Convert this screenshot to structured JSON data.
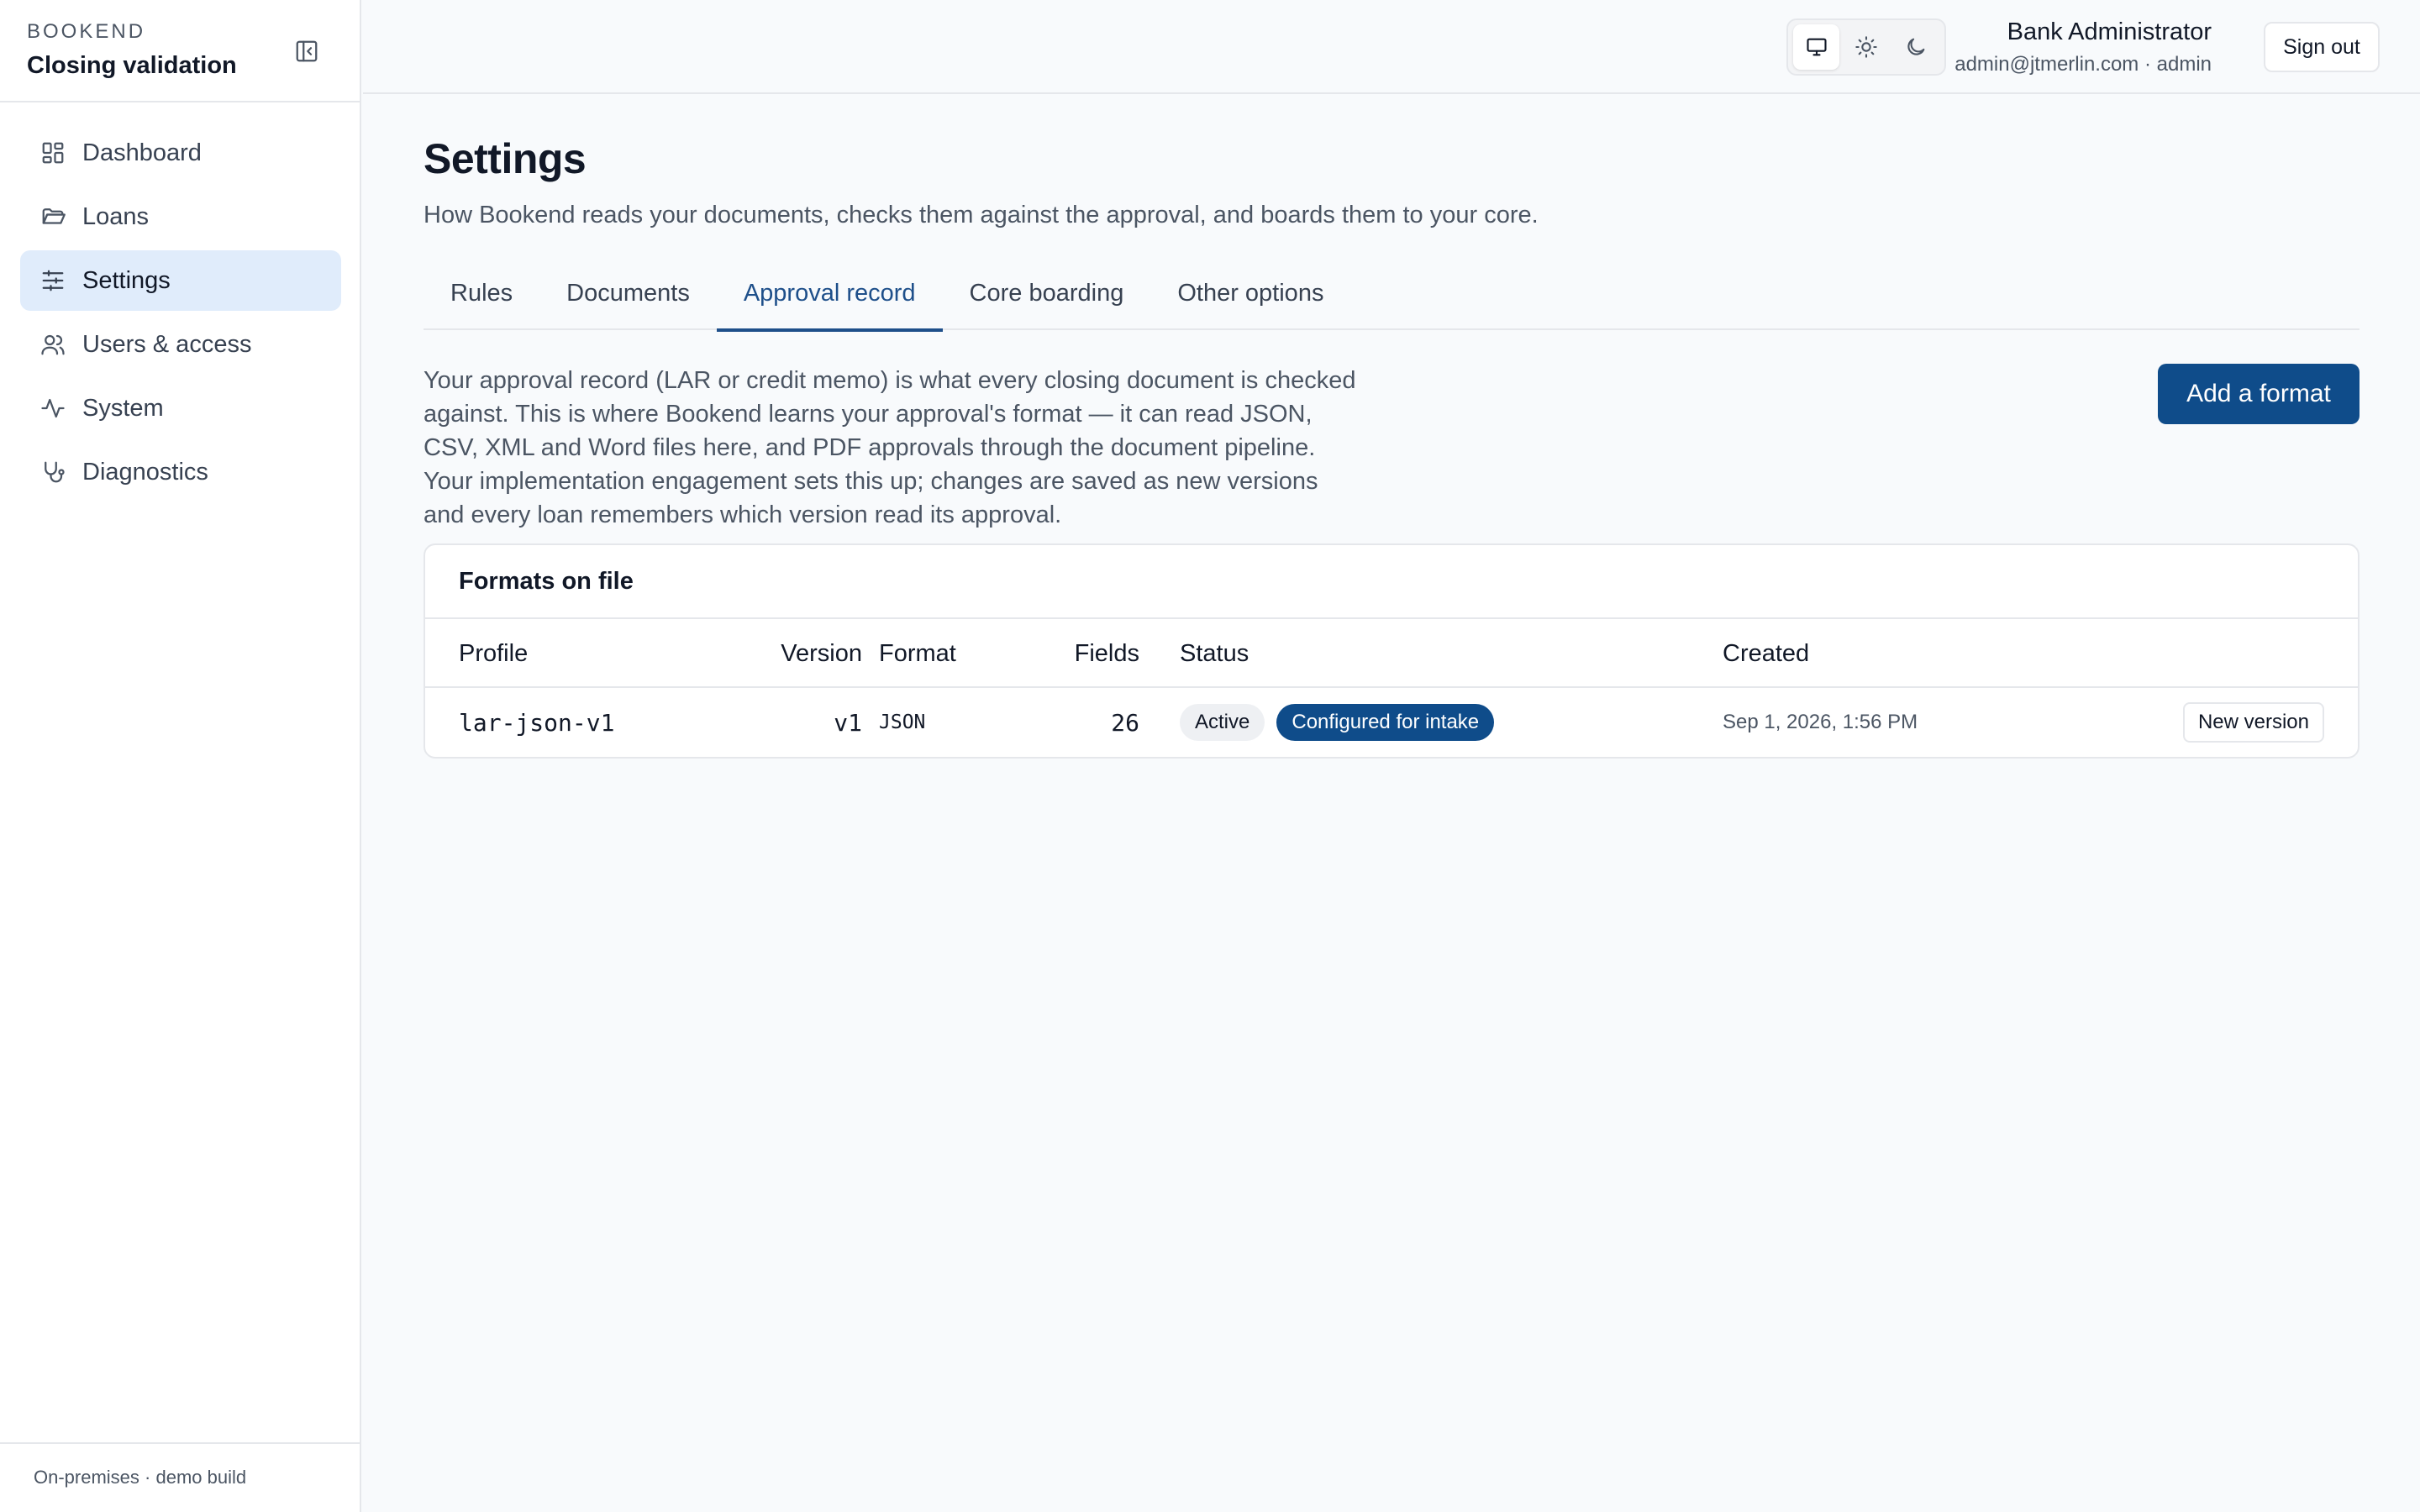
{
  "sidebar": {
    "brand": "BOOKEND",
    "subtitle": "Closing validation",
    "collapse_icon": "panel-collapse-icon",
    "items": [
      {
        "label": "Dashboard",
        "icon": "dashboard-icon",
        "active": false
      },
      {
        "label": "Loans",
        "icon": "folder-icon",
        "active": false
      },
      {
        "label": "Settings",
        "icon": "sliders-icon",
        "active": true
      },
      {
        "label": "Users & access",
        "icon": "users-icon",
        "active": false
      },
      {
        "label": "System",
        "icon": "activity-icon",
        "active": false
      },
      {
        "label": "Diagnostics",
        "icon": "stethoscope-icon",
        "active": false
      }
    ],
    "footer": "On-premises · demo build"
  },
  "header": {
    "theme_options": [
      "monitor-icon",
      "sun-icon",
      "moon-icon"
    ],
    "theme_selected": "monitor-icon",
    "user_name": "Bank Administrator",
    "user_email": "admin@jtmerlin.com · admin",
    "sign_out": "Sign out"
  },
  "main": {
    "title": "Settings",
    "description": "How Bookend reads your documents, checks them against the approval, and boards them to your core.",
    "tabs": [
      {
        "label": "Rules",
        "active": false
      },
      {
        "label": "Documents",
        "active": false
      },
      {
        "label": "Approval record",
        "active": true
      },
      {
        "label": "Core boarding",
        "active": false
      },
      {
        "label": "Other options",
        "active": false
      }
    ],
    "intro_lines": [
      "Your approval record (LAR or credit memo) is what every closing document is checked",
      "against. This is where Bookend learns your approval's format — it can read JSON,",
      "CSV, XML and Word files here, and PDF approvals through the document pipeline.",
      "Your implementation engagement sets this up; changes are saved as new versions",
      "and every loan remembers which version read its approval."
    ],
    "add_button": "Add a format",
    "card": {
      "title": "Formats on file",
      "columns": {
        "profile": "Profile",
        "version": "Version",
        "format": "Format",
        "fields": "Fields",
        "status": "Status",
        "created": "Created"
      },
      "rows": [
        {
          "profile": "lar-json-v1",
          "version": "v1",
          "format": "JSON",
          "fields": "26",
          "status_badges": [
            "Active",
            "Configured for intake"
          ],
          "created": "Sep 1, 2026, 1:56 PM",
          "action": "New version"
        }
      ]
    }
  },
  "colors": {
    "accent": "#0f4c8a",
    "active_nav_bg": "#e0ecfb",
    "active_tab": "#1e4f8a"
  }
}
